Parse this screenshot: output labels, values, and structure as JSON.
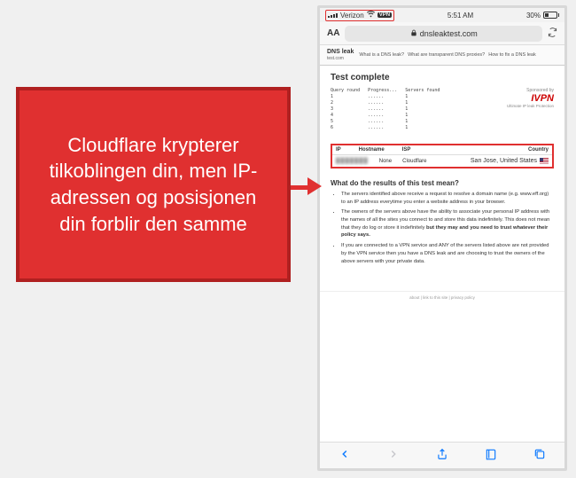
{
  "callout": {
    "text": "Cloudflare krypterer tilkoblingen din, men IP-adressen og posisjonen din forblir den samme"
  },
  "status": {
    "carrier": "Verizon",
    "vpn": "VPN",
    "time": "5:51 AM",
    "battery": "30%"
  },
  "url_bar": {
    "aa": "AA",
    "domain": "dnsleaktest.com"
  },
  "site": {
    "logo_main": "DNS leak",
    "logo_sub": "test.com",
    "nav1": "What is a DNS leak?",
    "nav2": "What are transparent DNS proxies?",
    "nav3": "How to fix a DNS leak"
  },
  "test": {
    "title": "Test complete",
    "stat_header": "Query round   Progress...   Servers found",
    "stat1": "1             ......        1",
    "stat2": "2             ......        1",
    "stat3": "3             ......        1",
    "stat4": "4             ......        1",
    "stat5": "5             ......        1",
    "stat6": "6             ......        1",
    "sponsor_label": "Sponsored by",
    "sponsor_logo": "IVPN",
    "sponsor_tag": "Ultimate IP leak Protection"
  },
  "table": {
    "h_ip": "IP",
    "h_hostname": "Hostname",
    "h_isp": "ISP",
    "h_country": "Country",
    "r_ip": "███████",
    "r_hostname": "None",
    "r_isp": "Cloudflare",
    "r_country": "San Jose, United States"
  },
  "explain": {
    "title": "What do the results of this test mean?",
    "li1": "The servers identified above receive a request to resolve a domain name (e.g. www.eff.org) to an IP address everytime you enter a website address in your browser.",
    "li2a": "The owners of the servers above have the ability to associate your personal IP address with the names of all the sites you connect to and store this data indefinitely. This does not mean that they do log or store it indefinitely ",
    "li2b": "but they may and you need to trust whatever their policy says.",
    "li3": "If you are connected to a VPN service and ANY of the servers listed above are not provided by the VPN service then you have a DNS leak and are choosing to trust the owners of the above servers with your private data."
  },
  "footer": "about | link to this site | privacy policy"
}
